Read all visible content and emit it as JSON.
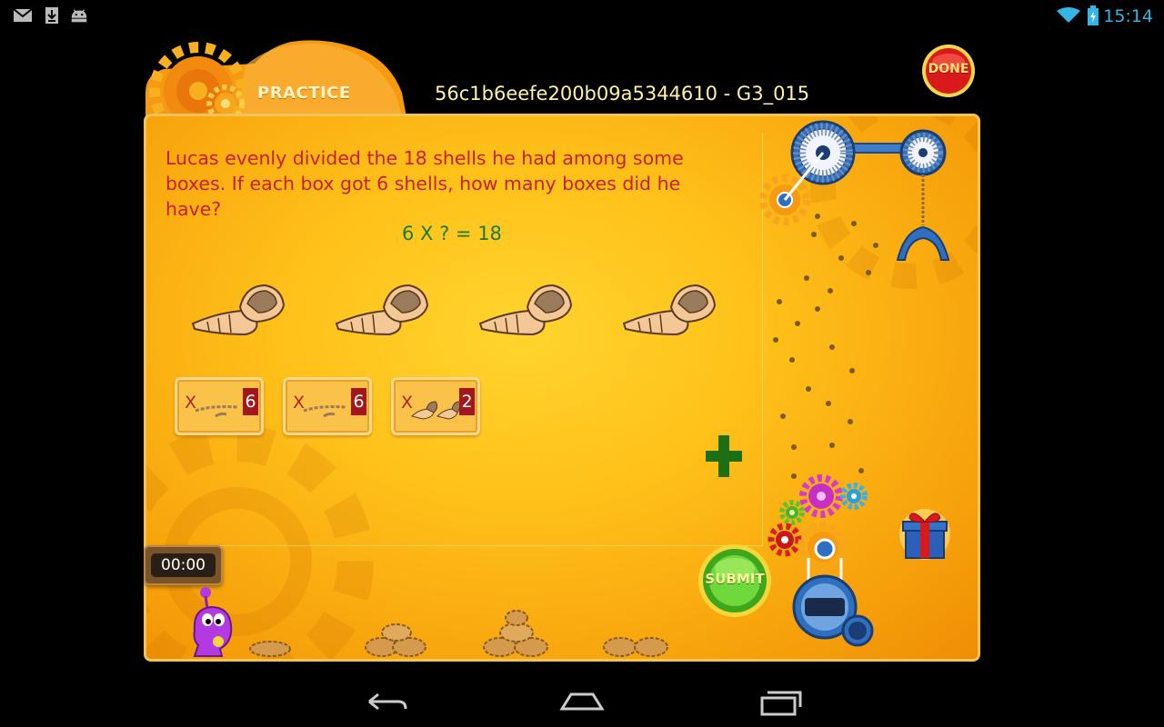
{
  "status_bar": {
    "time": "15:14",
    "icons": [
      "gmail-icon",
      "download-icon",
      "android-icon",
      "wifi-icon",
      "battery-icon"
    ]
  },
  "header": {
    "tab_label": "PRACTICE",
    "session_id": "56c1b6eefe200b09a5344610 - G3_015",
    "done_label": "DONE"
  },
  "question": {
    "text": "Lucas evenly divided the 18 shells he had among some boxes. If each box got 6 shells, how many boxes did he have?",
    "equation": "6 X ? = 18"
  },
  "shells_count": 4,
  "answer_tiles": [
    {
      "marker": "X",
      "value": "6"
    },
    {
      "marker": "X",
      "value": "6"
    },
    {
      "marker": "X",
      "value": "2"
    }
  ],
  "timer": "00:00",
  "submit_label": "SUBMIT",
  "colors": {
    "question_text": "#c8202a",
    "equation": "#1e7a18",
    "board": "#ffc21a",
    "accent_blue": "#33b5e5"
  }
}
